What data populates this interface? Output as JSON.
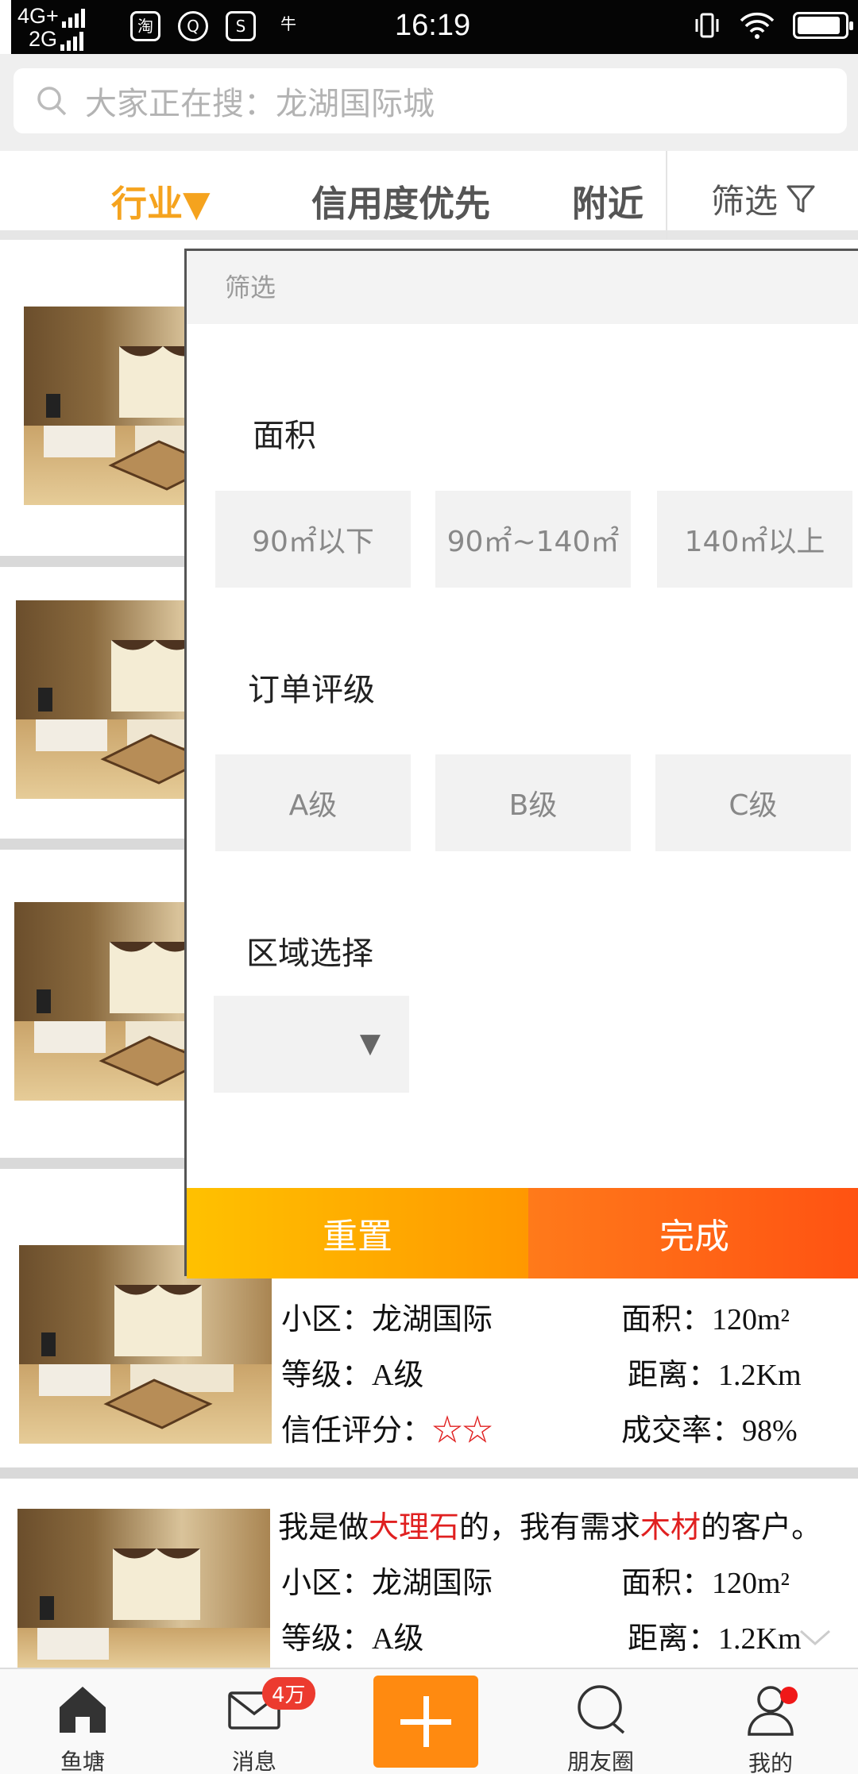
{
  "status_bar": {
    "network_top": "4G+",
    "network_bottom": "2G",
    "app_icons": [
      "淘",
      "Q",
      "S",
      "牛"
    ],
    "time": "16:19"
  },
  "search": {
    "placeholder": "大家正在搜：龙湖国际城"
  },
  "tabs": {
    "industry": "行业▼",
    "credit": "信用度优先",
    "nearby": "附近",
    "filter": "筛选"
  },
  "panel": {
    "header": "筛选",
    "area_title": "面积",
    "area_options": [
      "90㎡以下",
      "90㎡~140㎡",
      "140㎡以上"
    ],
    "grade_title": "订单评级",
    "grade_options": [
      "A级",
      "B级",
      "C级"
    ],
    "region_title": "区域选择",
    "region_caret": "▼",
    "reset_label": "重置",
    "done_label": "完成"
  },
  "listings": [
    {
      "community": "小区：龙湖国际",
      "area": "面积：120m²",
      "grade": "等级：A级",
      "distance": "距离：1.2Km",
      "trust_label": "信任评分：",
      "trust_stars": "☆☆",
      "deal_rate": "成交率：98%"
    },
    {
      "desc_prefix": "我是做",
      "desc_material": "大理石",
      "desc_mid": "的，我有需求",
      "desc_need": "木材",
      "desc_suffix": "的客户。",
      "community": "小区：龙湖国际",
      "area": "面积：120m²",
      "grade": "等级：A级",
      "distance": "距离：1.2Km"
    }
  ],
  "bottom_nav": {
    "pond": "鱼塘",
    "messages": "消息",
    "messages_badge": "4万",
    "friends": "朋友圈",
    "mine": "我的"
  },
  "colors": {
    "accent": "#f5a31e",
    "reset": "#ffc100",
    "done": "#ff5212",
    "highlight": "#e02020"
  }
}
